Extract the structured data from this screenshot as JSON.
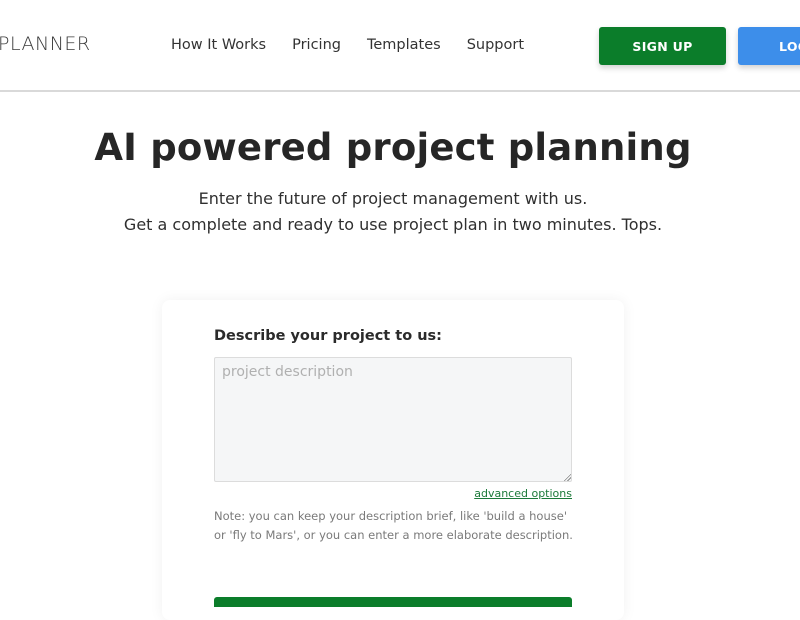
{
  "header": {
    "logo_text": "PLANNER",
    "nav": [
      "How It Works",
      "Pricing",
      "Templates",
      "Support"
    ],
    "signup_label": "SIGN UP",
    "login_label": "LOG"
  },
  "hero": {
    "title": "AI powered project planning",
    "subtitle_line1": "Enter the future of project management with us.",
    "subtitle_line2": "Get a complete and ready to use project plan in two minutes. Tops."
  },
  "form": {
    "label": "Describe your project to us:",
    "description_value": "",
    "description_placeholder": "project description",
    "advanced_link": "advanced options",
    "note": "Note: you can keep your description brief, like 'build a house' or 'fly to Mars', or you can enter a more elaborate description."
  },
  "colors": {
    "signup": "#0b7d2a",
    "login": "#3d8eea",
    "link": "#1c7a3a"
  }
}
